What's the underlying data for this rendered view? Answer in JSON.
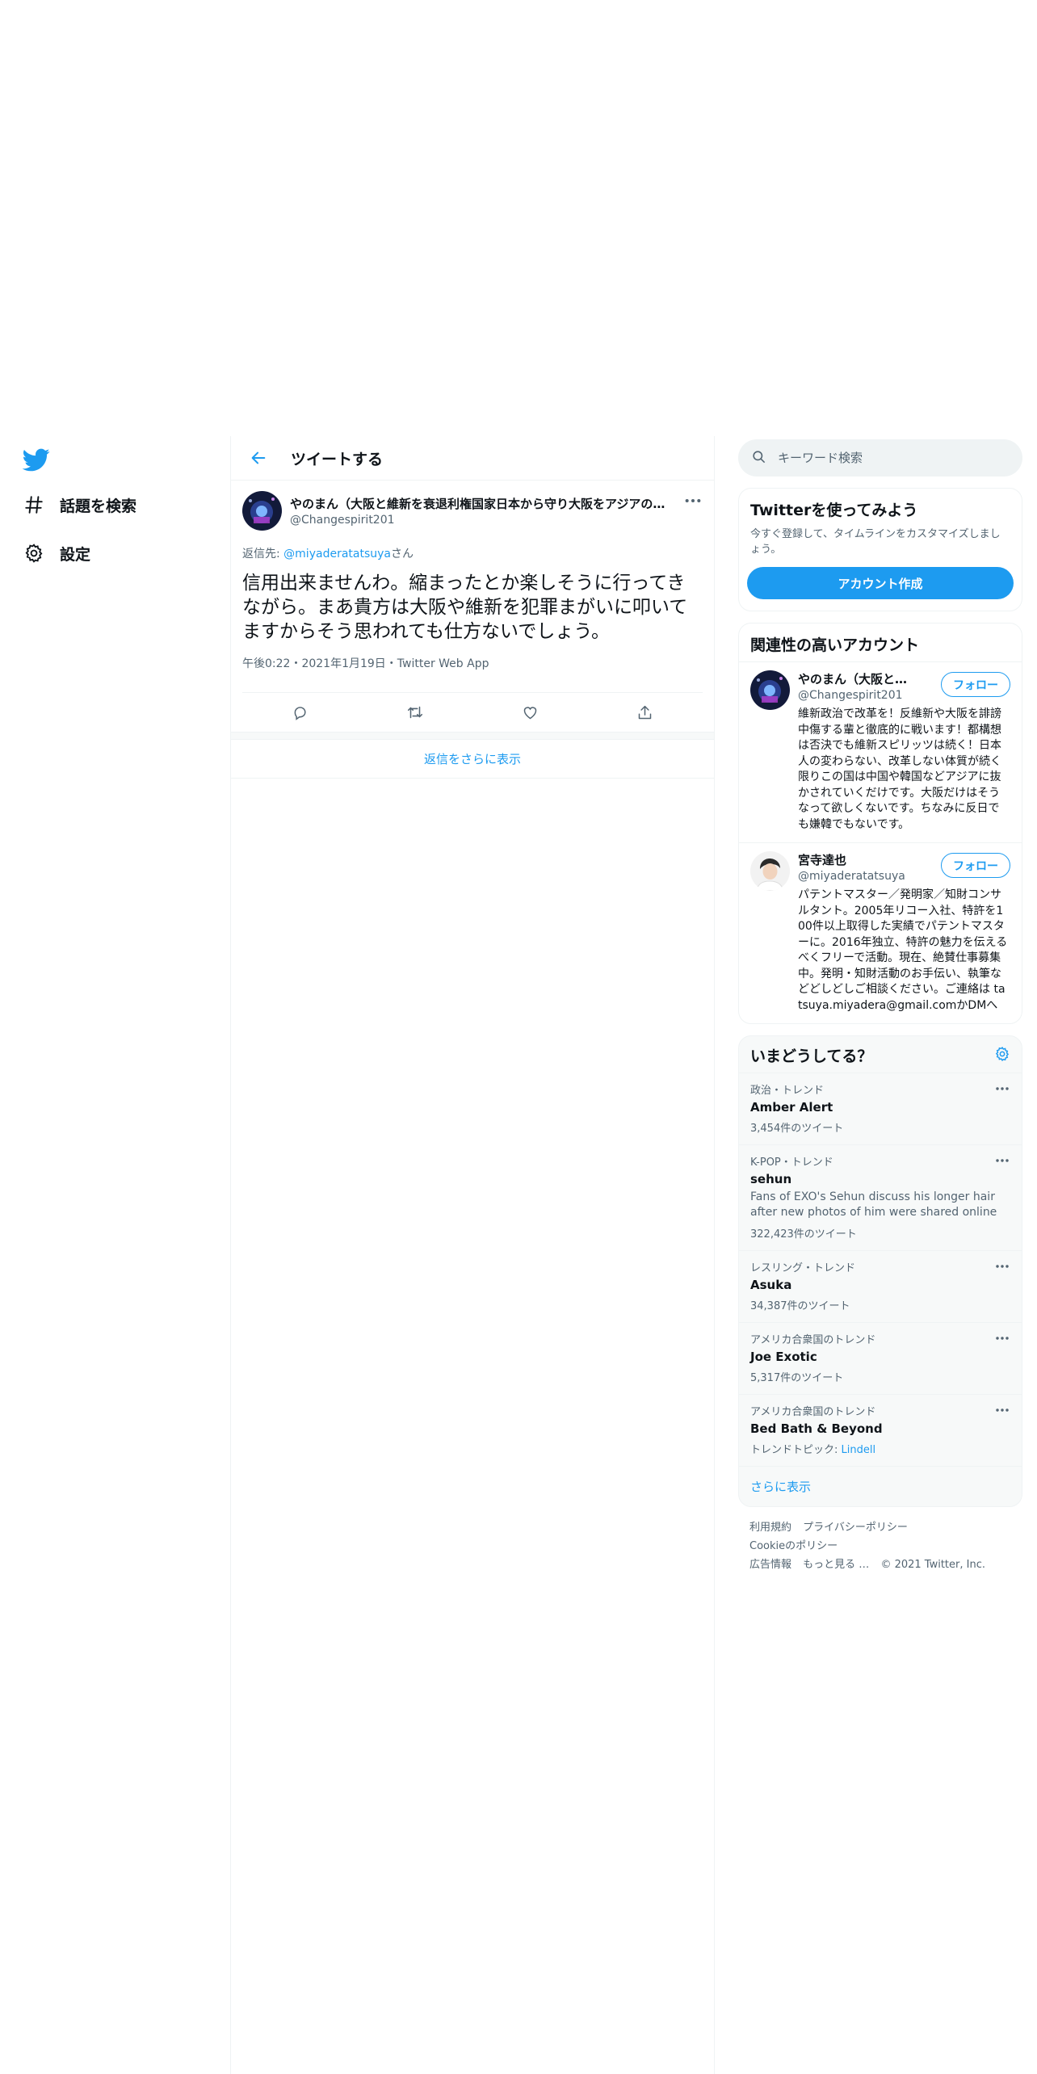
{
  "colors": {
    "accent": "#1d9bf0",
    "text": "#0f1419",
    "muted": "#536471",
    "border": "#eff3f4"
  },
  "nav": {
    "logo_icon": "twitter-bird-icon",
    "items": [
      {
        "label": "話題を検索",
        "icon": "hashtag-icon"
      },
      {
        "label": "設定",
        "icon": "gear-icon"
      }
    ]
  },
  "main": {
    "header_title": "ツイートする",
    "tweet": {
      "name": "やのまん（大阪と維新を衰退利権国家日本から守り大阪をアジアの…",
      "handle": "@Changespirit201",
      "reply_prefix": "返信先: ",
      "reply_handle": "@miyaderatatsuya",
      "reply_suffix": "さん",
      "text": "信用出来ませんわ。縮まったとか楽しそうに行ってきながら。まあ貴方は大阪や維新を犯罪まがいに叩いてますからそう思われても仕方ないでしょう。",
      "meta": "午後0:22・2021年1月19日・Twitter Web App"
    },
    "show_more_replies": "返信をさらに表示"
  },
  "sidebar": {
    "search_placeholder": "キーワード検索",
    "join": {
      "title": "Twitterを使ってみよう",
      "subtitle": "今すぐ登録して、タイムラインをカスタマイズしましょう。",
      "signup_label": "アカウント作成"
    },
    "relevant": {
      "title": "関連性の高いアカウント",
      "follow_label": "フォロー",
      "accounts": [
        {
          "name": "やのまん（大阪と維新を衰退利権国家日本から守り大阪をアジアの…",
          "handle": "@Changespirit201",
          "bio": "維新政治で改革を！反維新や大阪を誹謗中傷する輩と徹底的に戦います！都構想は否決でも維新スピリッツは続く！日本人の変わらない、改革しない体質が続く限りこの国は中国や韓国などアジアに抜かされていくだけです。大阪だけはそうなって欲しくないです。ちなみに反日でも嫌韓でもないです。"
        },
        {
          "name": "宮寺達也",
          "handle": "@miyaderatatsuya",
          "bio": "パテントマスター／発明家／知財コンサルタント。2005年リコー入社、特許を100件以上取得した実績でパテントマスターに。2016年独立、特許の魅力を伝えるべくフリーで活動。現在、絶賛仕事募集中。発明・知財活動のお手伝い、執筆などどしどしご相談ください。ご連絡は tatsuya.miyadera@gmail.comかDMへ"
        }
      ]
    },
    "trends": {
      "title": "いまどうしてる？",
      "items": [
        {
          "context": "政治・トレンド",
          "name": "Amber Alert",
          "desc": "",
          "count": "3,454件のツイート",
          "topic_prefix": "",
          "topic": ""
        },
        {
          "context": "K-POP・トレンド",
          "name": "sehun",
          "desc": "Fans of EXO's Sehun discuss his longer hair after new photos of him were shared online",
          "count": "322,423件のツイート",
          "topic_prefix": "",
          "topic": ""
        },
        {
          "context": "レスリング・トレンド",
          "name": "Asuka",
          "desc": "",
          "count": "34,387件のツイート",
          "topic_prefix": "",
          "topic": ""
        },
        {
          "context": "アメリカ合衆国のトレンド",
          "name": "Joe Exotic",
          "desc": "",
          "count": "5,317件のツイート",
          "topic_prefix": "",
          "topic": ""
        },
        {
          "context": "アメリカ合衆国のトレンド",
          "name": "Bed Bath & Beyond",
          "desc": "",
          "count": "",
          "topic_prefix": "トレンドトピック: ",
          "topic": "Lindell"
        }
      ],
      "show_more": "さらに表示"
    },
    "footer": {
      "links": [
        "利用規約",
        "プライバシーポリシー",
        "Cookieのポリシー",
        "広告情報",
        "もっと見る …"
      ],
      "copyright": "© 2021 Twitter, Inc."
    }
  }
}
